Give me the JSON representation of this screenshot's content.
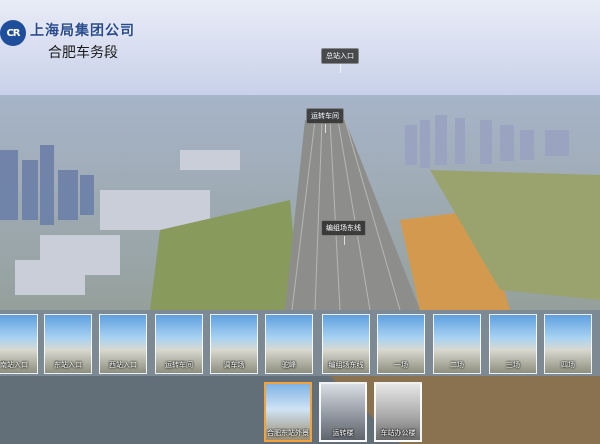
{
  "brand": {
    "badge": "CR",
    "org_name": "上海局集团公司",
    "unit_name": "合肥车务段"
  },
  "hotspots": [
    {
      "label": "总站入口"
    },
    {
      "label": "运转车间"
    },
    {
      "label": "编组场东线"
    }
  ],
  "scene_strip": [
    {
      "label": "南站入口"
    },
    {
      "label": "东站入口"
    },
    {
      "label": "西站入口"
    },
    {
      "label": "运转车间"
    },
    {
      "label": "调车场"
    },
    {
      "label": "驼峰"
    },
    {
      "label": "编组场东线"
    },
    {
      "label": "一场"
    },
    {
      "label": "二场"
    },
    {
      "label": "三场"
    },
    {
      "label": "四场"
    }
  ],
  "sub_strip": [
    {
      "label": "合肥东站外景"
    },
    {
      "label": "运转楼"
    },
    {
      "label": "车站办公楼"
    }
  ],
  "colors": {
    "accent": "#f2a43a",
    "brand_blue": "#1f4e9a"
  }
}
